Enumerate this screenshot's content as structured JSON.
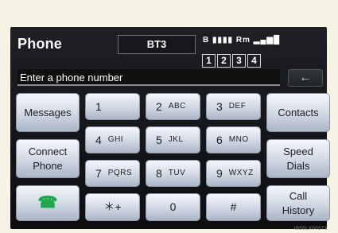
{
  "header": {
    "title": "Phone",
    "device": "BT3"
  },
  "status": {
    "bluetooth": "B",
    "battery": "▮▮▮▮",
    "roaming": "Rm",
    "signal": "▂▄▆█"
  },
  "speed_dial_pages": [
    "1",
    "2",
    "3",
    "4"
  ],
  "entry": {
    "placeholder": "Enter a phone number",
    "back_symbol": "←"
  },
  "left": {
    "messages": "Messages",
    "connect_phone": "Connect\nPhone"
  },
  "keypad": [
    {
      "num": "1",
      "letters": ""
    },
    {
      "num": "2",
      "letters": "ABC"
    },
    {
      "num": "3",
      "letters": "DEF"
    },
    {
      "num": "4",
      "letters": "GHI"
    },
    {
      "num": "5",
      "letters": "JKL"
    },
    {
      "num": "6",
      "letters": "MNO"
    },
    {
      "num": "7",
      "letters": "PQRS"
    },
    {
      "num": "8",
      "letters": "TUV"
    },
    {
      "num": "9",
      "letters": "WXYZ"
    },
    {
      "num": "＊+",
      "letters": ""
    },
    {
      "num": "0",
      "letters": ""
    },
    {
      "num": "#",
      "letters": ""
    }
  ],
  "right": {
    "contacts": "Contacts",
    "speed_dials": "Speed\nDials",
    "call_history": "Call\nHistory"
  },
  "watermark": "IB55LX005T1",
  "colors": {
    "call_icon": "#1aa84a",
    "screen_bg": "#0d0e10"
  }
}
